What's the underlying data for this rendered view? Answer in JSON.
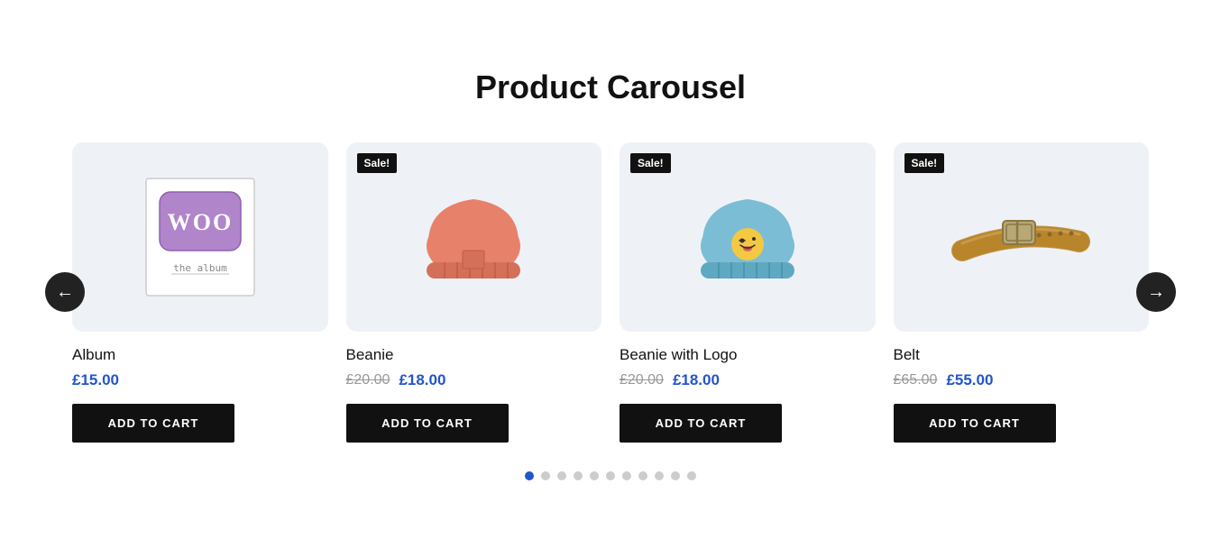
{
  "page": {
    "title": "Product Carousel"
  },
  "navigation": {
    "prev_label": "←",
    "next_label": "→"
  },
  "products": [
    {
      "id": "album",
      "name": "Album",
      "sale": false,
      "price_original": null,
      "price_current": "£15.00",
      "add_to_cart_label": "ADD TO CART",
      "illustration": "album"
    },
    {
      "id": "beanie",
      "name": "Beanie",
      "sale": true,
      "sale_label": "Sale!",
      "price_original": "£20.00",
      "price_current": "£18.00",
      "add_to_cart_label": "ADD TO CART",
      "illustration": "beanie-plain"
    },
    {
      "id": "beanie-logo",
      "name": "Beanie with Logo",
      "sale": true,
      "sale_label": "Sale!",
      "price_original": "£20.00",
      "price_current": "£18.00",
      "add_to_cart_label": "ADD TO CART",
      "illustration": "beanie-logo"
    },
    {
      "id": "belt",
      "name": "Belt",
      "sale": true,
      "sale_label": "Sale!",
      "price_original": "£65.00",
      "price_current": "£55.00",
      "add_to_cart_label": "ADD TO CART",
      "illustration": "belt"
    }
  ],
  "dots": {
    "total": 11,
    "active_index": 0
  }
}
